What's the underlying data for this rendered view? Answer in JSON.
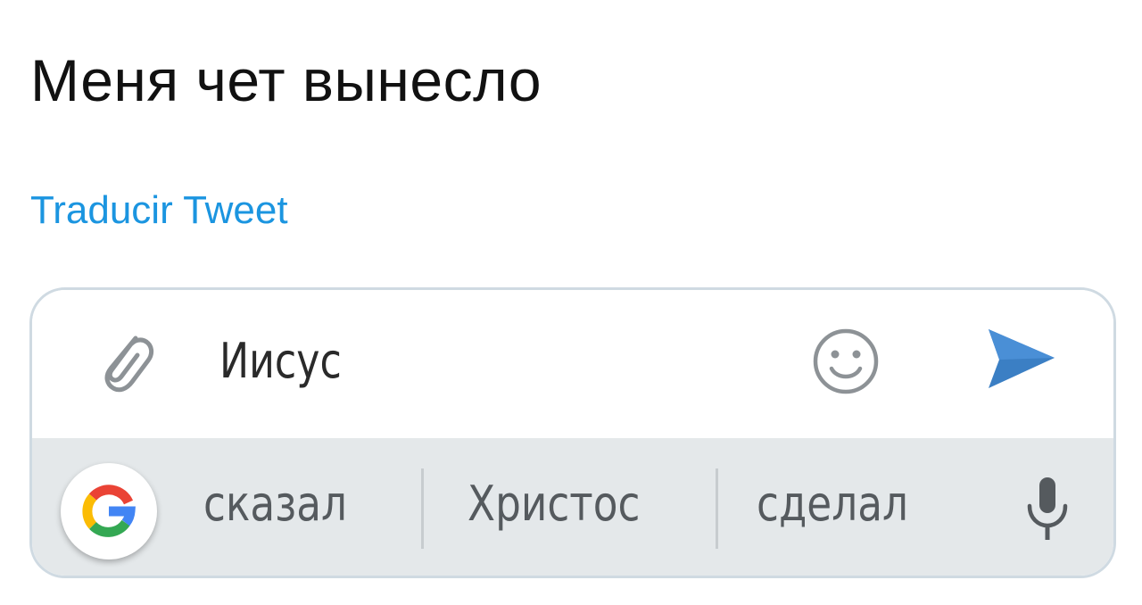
{
  "tweet": {
    "text": "Меня чет вынесло",
    "translate_label": "Traducir Tweet"
  },
  "compose": {
    "attach_icon": "paperclip-icon",
    "input_value": "Иисус",
    "emoji_icon": "smiley-icon",
    "send_icon": "send-arrow-icon",
    "send_color": "#3b7fc4"
  },
  "suggestions": {
    "google_icon": "google-g-icon",
    "items": [
      "сказал",
      "Христос",
      "сделал"
    ],
    "mic_icon": "microphone-icon"
  },
  "colors": {
    "link": "#1b95e0",
    "suggest_bar_bg": "#e4e8ea",
    "card_border": "#cfdae2"
  }
}
